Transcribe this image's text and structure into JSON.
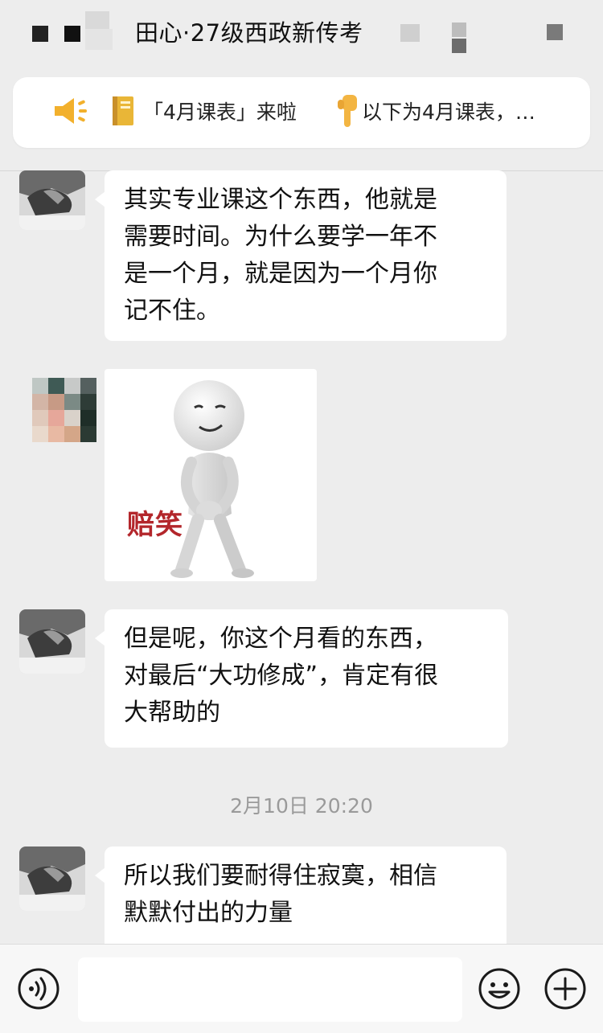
{
  "header": {
    "title": "田心·27级西政新传考"
  },
  "pinned_notice": {
    "speaker_icon": "speaker-icon",
    "book_icon": "notebook-icon",
    "text": "「4月课表」来啦",
    "hand_icon": "pointing-down-hand-icon",
    "text2": "以下为4月课表，…"
  },
  "messages": [
    {
      "type": "text",
      "lines": [
        "其实专业课这个东西，他就是",
        "需要时间。为什么要学一年不",
        "是一个月，就是因为一个月你",
        "记不住。"
      ]
    },
    {
      "type": "sticker",
      "caption": "赔笑"
    },
    {
      "type": "text",
      "lines": [
        "但是呢，你这个月看的东西，",
        "对最后“大功修成”，肯定有很",
        "大帮助的"
      ]
    },
    {
      "type": "timestamp",
      "text": "2月10日 20:20"
    },
    {
      "type": "text",
      "lines": [
        "所以我们要耐得住寂寞，相信",
        "默默付出的力量"
      ]
    }
  ],
  "input_bar": {
    "voice_icon": "voice-icon",
    "emoji_icon": "emoji-icon",
    "plus_icon": "plus-icon",
    "input_value": ""
  },
  "colors": {
    "background": "#ededed",
    "bubble": "#ffffff",
    "sticker_caption": "#b3262b",
    "timestamp": "#9a9a9a"
  }
}
